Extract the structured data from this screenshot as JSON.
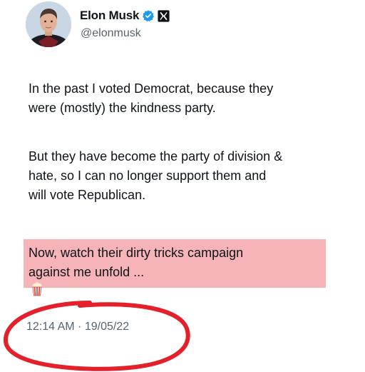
{
  "author": {
    "display_name": "Elon Musk",
    "handle": "@elonmusk",
    "avatar_icon": "profile-photo",
    "verified_icon": "verified-checkmark-icon",
    "affiliation_icon": "x-logo-icon"
  },
  "tweet": {
    "paragraph_1": [
      "In the past I voted Democrat, because they",
      "were (mostly) the kindness party."
    ],
    "paragraph_2": [
      "But they have become the party of division &",
      "hate, so I can no longer support them and",
      "will vote Republican."
    ],
    "paragraph_3": [
      "Now, watch their dirty tricks campaign",
      "against me unfold ..."
    ],
    "emoji_icon": "popcorn-icon",
    "timestamp": "12:14 AM · 19/05/22"
  },
  "colors": {
    "verified_blue": "#1d9bf0",
    "highlight_pink": "#f6b4b8",
    "annotation_red": "#e4202a",
    "secondary_text": "#536471"
  }
}
